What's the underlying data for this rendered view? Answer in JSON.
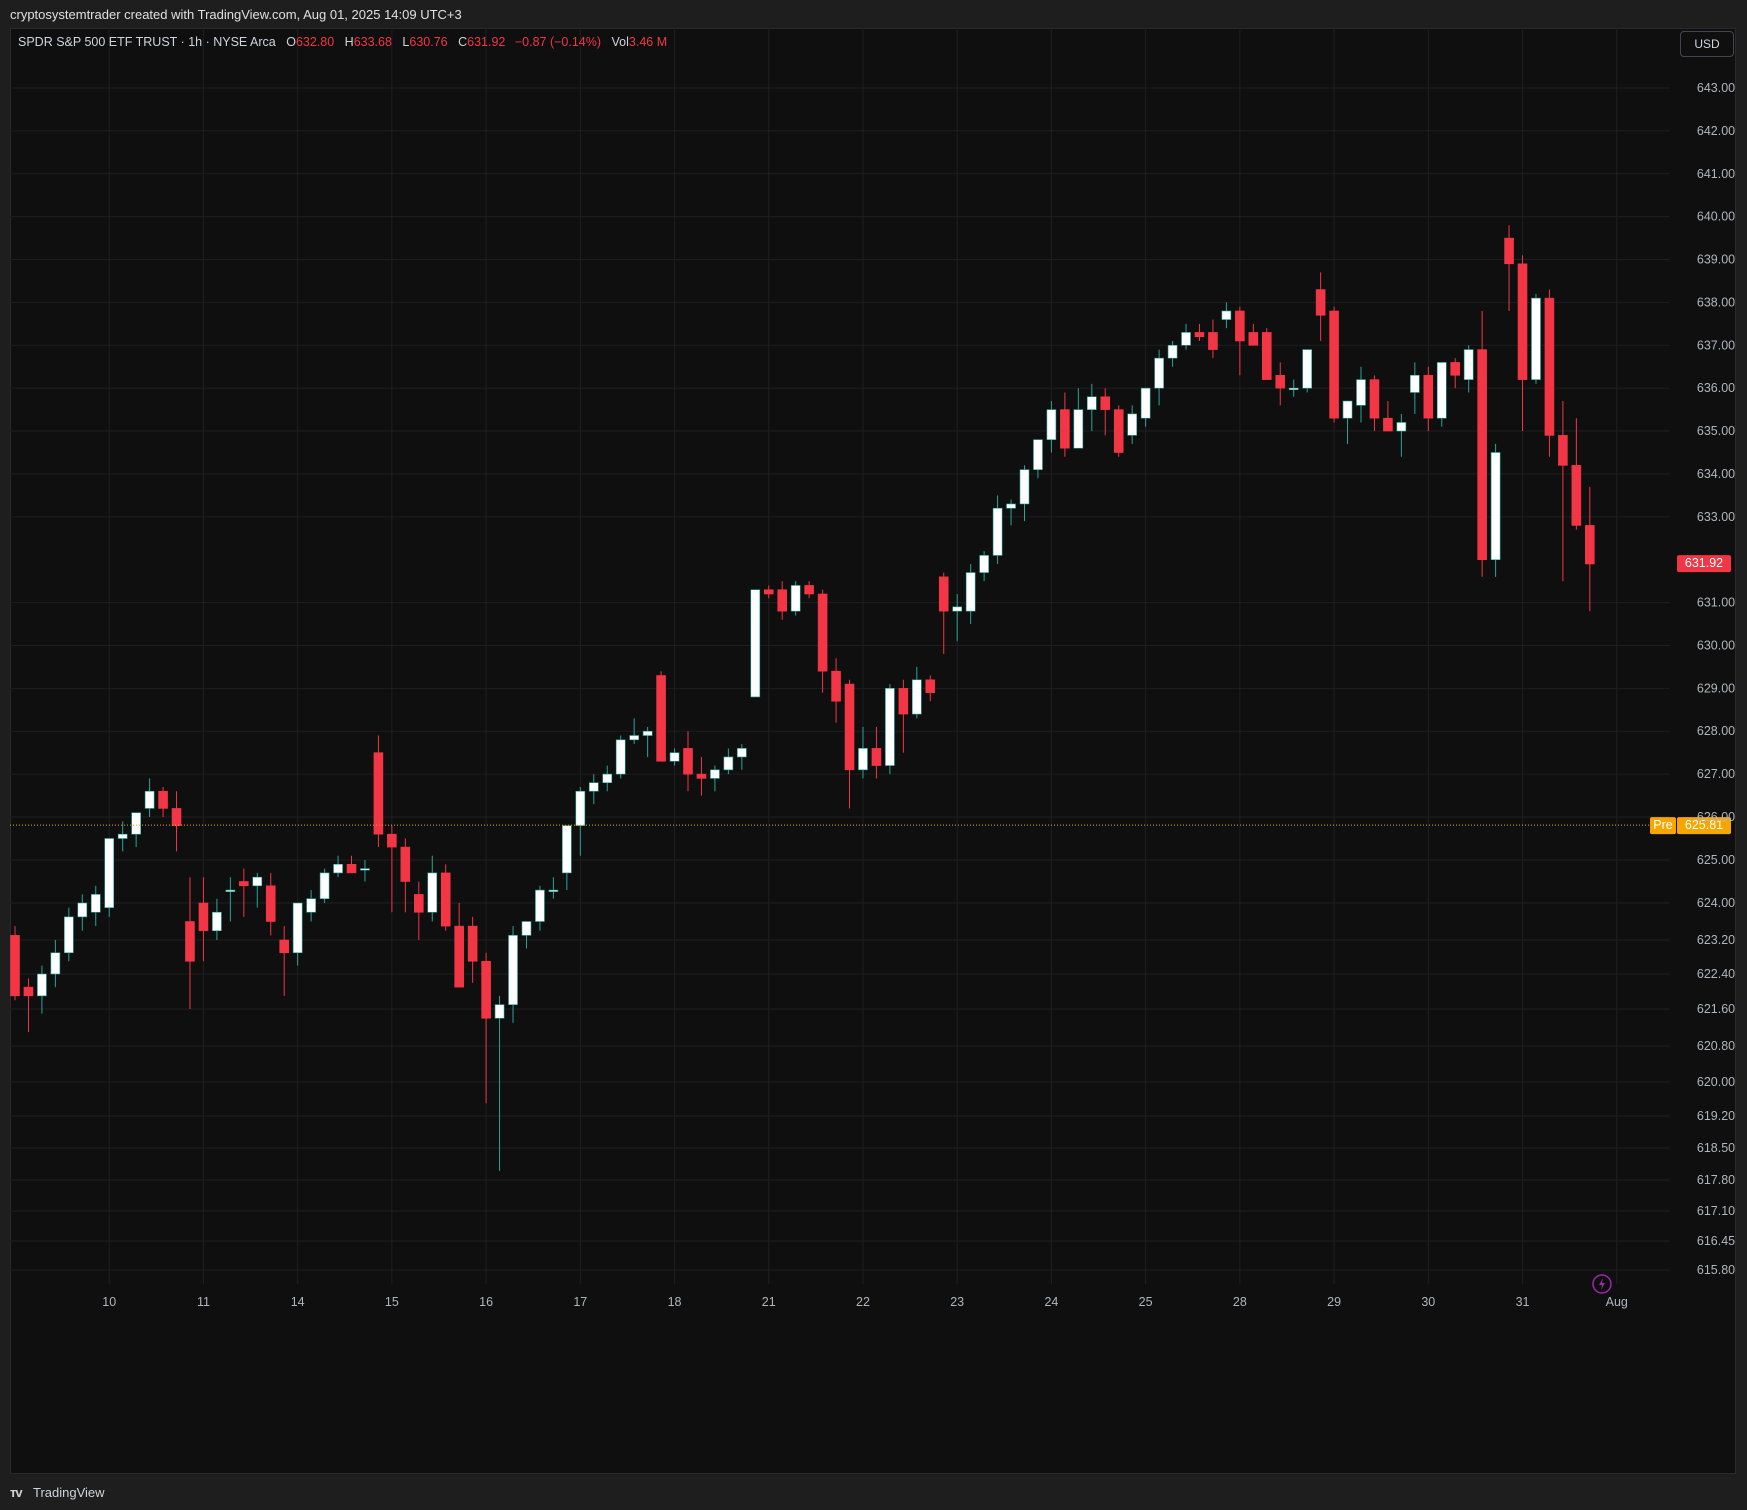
{
  "header": {
    "attribution": "cryptosystemtrader created with TradingView.com, Aug 01, 2025 14:09 UTC+3"
  },
  "legend": {
    "symbol": "SPDR S&P 500 ETF TRUST · 1h · NYSE Arca",
    "o_label": "O",
    "o_value": "632.80",
    "h_label": "H",
    "h_value": "633.68",
    "l_label": "L",
    "l_value": "630.76",
    "c_label": "C",
    "c_value": "631.92",
    "change": "−0.87 (−0.14%)",
    "vol_label": "Vol",
    "vol_value": "3.46 M"
  },
  "currency": "USD",
  "footer": {
    "brand": "TradingView"
  },
  "colors": {
    "up": "#ffffff",
    "down": "#f23645",
    "up_wick": "#26a69a",
    "down_wick": "#f23645",
    "pre": "#f7a600",
    "bg": "#0f0f0f",
    "grid": "#1f1f1f"
  },
  "chart_data": {
    "type": "candlestick",
    "title": "SPDR S&P 500 ETF TRUST · 1h · NYSE Arca",
    "y_ticks": [
      "643.00",
      "642.00",
      "641.00",
      "640.00",
      "639.00",
      "638.00",
      "637.00",
      "636.00",
      "635.00",
      "634.00",
      "633.00",
      "631.00",
      "630.00",
      "629.00",
      "628.00",
      "627.00",
      "626.00",
      "625.00",
      "624.00",
      "623.20",
      "622.40",
      "621.60",
      "620.80",
      "620.00",
      "619.20",
      "618.50",
      "617.80",
      "617.10",
      "616.45",
      "615.80"
    ],
    "x_ticks": [
      {
        "label": "10",
        "idx": 7
      },
      {
        "label": "11",
        "idx": 14
      },
      {
        "label": "14",
        "idx": 21
      },
      {
        "label": "15",
        "idx": 28
      },
      {
        "label": "16",
        "idx": 35
      },
      {
        "label": "17",
        "idx": 42
      },
      {
        "label": "18",
        "idx": 49
      },
      {
        "label": "21",
        "idx": 56
      },
      {
        "label": "22",
        "idx": 63
      },
      {
        "label": "23",
        "idx": 70
      },
      {
        "label": "24",
        "idx": 77
      },
      {
        "label": "25",
        "idx": 84
      },
      {
        "label": "28",
        "idx": 91
      },
      {
        "label": "29",
        "idx": 98
      },
      {
        "label": "30",
        "idx": 105
      },
      {
        "label": "31",
        "idx": 112
      },
      {
        "label": "Aug",
        "idx": 119
      }
    ],
    "last_price": {
      "value": 631.92,
      "label": "631.92"
    },
    "pre_market": {
      "value": 625.81,
      "tag": "Pre",
      "label": "625.81"
    },
    "ohlc": [
      [
        623.3,
        623.5,
        621.8,
        621.9
      ],
      [
        622.1,
        622.3,
        621.1,
        621.9
      ],
      [
        621.9,
        622.6,
        621.5,
        622.4
      ],
      [
        622.4,
        623.2,
        622.1,
        622.9
      ],
      [
        622.9,
        623.9,
        622.7,
        623.7
      ],
      [
        623.7,
        624.2,
        623.4,
        624.0
      ],
      [
        623.8,
        624.4,
        623.5,
        624.2
      ],
      [
        623.9,
        625.5,
        623.7,
        625.5
      ],
      [
        625.5,
        625.9,
        625.2,
        625.6
      ],
      [
        625.6,
        626.0,
        625.3,
        626.1
      ],
      [
        626.2,
        626.9,
        626.0,
        626.6
      ],
      [
        626.6,
        626.7,
        626.0,
        626.2
      ],
      [
        626.2,
        626.6,
        625.2,
        625.8
      ],
      [
        623.6,
        624.6,
        621.6,
        622.7
      ],
      [
        624.0,
        624.6,
        622.7,
        623.4
      ],
      [
        623.4,
        624.1,
        623.2,
        623.8
      ],
      [
        624.3,
        624.6,
        623.6,
        624.3
      ],
      [
        624.5,
        624.8,
        623.7,
        624.4
      ],
      [
        624.4,
        624.7,
        623.9,
        624.6
      ],
      [
        624.4,
        624.7,
        623.3,
        623.6
      ],
      [
        623.2,
        623.5,
        621.9,
        622.9
      ],
      [
        622.9,
        624.0,
        622.6,
        624.0
      ],
      [
        623.8,
        624.3,
        623.6,
        624.1
      ],
      [
        624.1,
        624.8,
        624.0,
        624.7
      ],
      [
        624.7,
        625.1,
        624.6,
        624.9
      ],
      [
        624.9,
        625.1,
        624.7,
        624.7
      ],
      [
        624.8,
        625.0,
        624.5,
        624.8
      ],
      [
        627.5,
        627.9,
        625.3,
        625.6
      ],
      [
        625.6,
        625.8,
        623.8,
        625.3
      ],
      [
        625.3,
        625.5,
        623.8,
        624.5
      ],
      [
        624.2,
        624.5,
        623.2,
        623.8
      ],
      [
        623.8,
        625.1,
        623.6,
        624.7
      ],
      [
        624.7,
        624.9,
        623.4,
        623.5
      ],
      [
        623.5,
        624.0,
        622.1,
        622.1
      ],
      [
        623.5,
        623.7,
        622.2,
        622.7
      ],
      [
        622.7,
        622.9,
        619.5,
        621.4
      ],
      [
        621.4,
        621.9,
        618.0,
        621.7
      ],
      [
        621.7,
        623.5,
        621.3,
        623.3
      ],
      [
        623.3,
        623.6,
        623.0,
        623.6
      ],
      [
        623.6,
        624.4,
        623.4,
        624.3
      ],
      [
        624.3,
        624.6,
        624.1,
        624.3
      ],
      [
        624.7,
        625.6,
        624.3,
        625.8
      ],
      [
        625.8,
        626.7,
        625.1,
        626.6
      ],
      [
        626.6,
        627.0,
        626.3,
        626.8
      ],
      [
        626.8,
        627.2,
        626.6,
        627.0
      ],
      [
        627.0,
        627.9,
        626.9,
        627.8
      ],
      [
        627.8,
        628.3,
        627.7,
        627.9
      ],
      [
        627.9,
        628.1,
        627.4,
        628.0
      ],
      [
        629.3,
        629.4,
        627.3,
        627.3
      ],
      [
        627.3,
        627.6,
        627.2,
        627.5
      ],
      [
        627.6,
        628.0,
        626.6,
        627.0
      ],
      [
        627.0,
        627.4,
        626.5,
        626.9
      ],
      [
        626.9,
        627.2,
        626.6,
        627.1
      ],
      [
        627.1,
        627.6,
        627.0,
        627.4
      ],
      [
        627.4,
        627.7,
        627.1,
        627.6
      ],
      [
        628.8,
        631.3,
        628.8,
        631.3
      ],
      [
        631.3,
        631.4,
        631.1,
        631.2
      ],
      [
        631.3,
        631.5,
        630.6,
        630.8
      ],
      [
        630.8,
        631.5,
        630.7,
        631.4
      ],
      [
        631.4,
        631.5,
        631.1,
        631.2
      ],
      [
        631.2,
        631.3,
        628.9,
        629.4
      ],
      [
        629.4,
        629.7,
        628.2,
        628.7
      ],
      [
        629.1,
        629.2,
        626.2,
        627.1
      ],
      [
        627.1,
        628.1,
        626.9,
        627.6
      ],
      [
        627.6,
        628.1,
        626.9,
        627.2
      ],
      [
        627.2,
        629.1,
        627.0,
        629.0
      ],
      [
        629.0,
        629.2,
        627.5,
        628.4
      ],
      [
        628.4,
        629.5,
        628.3,
        629.2
      ],
      [
        629.2,
        629.3,
        628.7,
        628.9
      ],
      [
        631.6,
        631.7,
        629.8,
        630.8
      ],
      [
        630.8,
        631.2,
        630.1,
        630.9
      ],
      [
        630.8,
        631.9,
        630.5,
        631.7
      ],
      [
        631.7,
        632.2,
        631.5,
        632.1
      ],
      [
        632.1,
        633.5,
        631.9,
        633.2
      ],
      [
        633.2,
        633.4,
        632.8,
        633.3
      ],
      [
        633.3,
        634.2,
        632.9,
        634.1
      ],
      [
        634.1,
        634.4,
        633.9,
        634.8
      ],
      [
        634.8,
        635.7,
        634.5,
        635.5
      ],
      [
        635.5,
        635.9,
        634.4,
        634.6
      ],
      [
        634.6,
        636.0,
        634.6,
        635.5
      ],
      [
        635.5,
        636.1,
        635.0,
        635.8
      ],
      [
        635.8,
        636.0,
        634.9,
        635.5
      ],
      [
        635.5,
        635.6,
        634.4,
        634.5
      ],
      [
        634.9,
        635.6,
        634.7,
        635.4
      ],
      [
        635.3,
        635.9,
        635.1,
        636.0
      ],
      [
        636.0,
        636.9,
        635.6,
        636.7
      ],
      [
        636.7,
        637.1,
        636.5,
        637.0
      ],
      [
        637.0,
        637.5,
        636.9,
        637.3
      ],
      [
        637.3,
        637.5,
        637.1,
        637.2
      ],
      [
        637.3,
        637.6,
        636.7,
        636.9
      ],
      [
        637.6,
        638.0,
        637.4,
        637.8
      ],
      [
        637.8,
        637.9,
        636.3,
        637.1
      ],
      [
        637.3,
        637.5,
        637.0,
        637.0
      ],
      [
        637.3,
        637.4,
        636.3,
        636.2
      ],
      [
        636.3,
        636.6,
        635.6,
        636.0
      ],
      [
        636.0,
        636.2,
        635.8,
        636.0
      ],
      [
        636.0,
        636.9,
        635.9,
        636.9
      ],
      [
        638.3,
        638.7,
        637.1,
        637.7
      ],
      [
        637.8,
        637.9,
        635.2,
        635.3
      ],
      [
        635.3,
        635.7,
        634.7,
        635.7
      ],
      [
        635.6,
        636.5,
        635.2,
        636.2
      ],
      [
        636.2,
        636.3,
        635.0,
        635.3
      ],
      [
        635.3,
        635.7,
        635.0,
        635.0
      ],
      [
        635.0,
        635.4,
        634.4,
        635.2
      ],
      [
        635.9,
        636.6,
        635.4,
        636.3
      ],
      [
        636.3,
        636.5,
        635.0,
        635.3
      ],
      [
        635.3,
        636.6,
        635.1,
        636.6
      ],
      [
        636.6,
        636.7,
        636.0,
        636.3
      ],
      [
        636.2,
        637.0,
        635.9,
        636.9
      ],
      [
        636.9,
        637.8,
        631.6,
        632.0
      ],
      [
        632.0,
        634.7,
        631.6,
        634.5
      ],
      [
        639.5,
        639.8,
        637.8,
        638.9
      ],
      [
        638.9,
        639.1,
        635.0,
        636.2
      ],
      [
        636.2,
        638.2,
        636.1,
        638.1
      ],
      [
        638.1,
        638.3,
        634.4,
        634.9
      ],
      [
        634.9,
        635.7,
        631.5,
        634.2
      ],
      [
        634.2,
        635.3,
        632.7,
        632.8
      ],
      [
        632.8,
        633.7,
        630.8,
        631.9
      ]
    ]
  }
}
